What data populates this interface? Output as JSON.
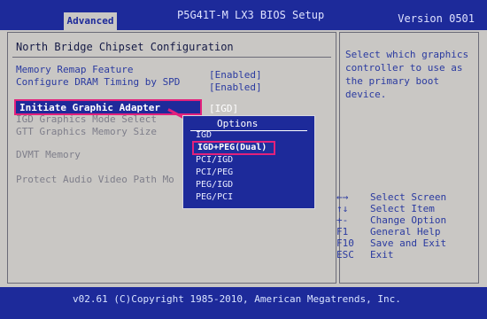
{
  "header": {
    "tab_label": "Advanced",
    "title": "P5G41T-M LX3 BIOS Setup",
    "version": "Version 0501"
  },
  "main": {
    "section_title": "North Bridge Chipset Configuration",
    "rows": [
      {
        "label": "Memory Remap Feature",
        "value": "[Enabled]"
      },
      {
        "label": "Configure DRAM Timing by SPD",
        "value": "[Enabled]"
      },
      {
        "label": "Initiate Graphic Adapter",
        "value": "[IGD]"
      },
      {
        "label": "IGD Graphics Mode Select",
        "value": ""
      },
      {
        "label": "GTT Graphics Memory Size",
        "value": ""
      },
      {
        "label": "DVMT Memory",
        "value": ""
      },
      {
        "label": "Protect Audio Video Path Mo",
        "value": ""
      }
    ]
  },
  "popup": {
    "title": "Options",
    "options": [
      "IGD",
      "IGD+PEG(Dual)",
      "PCI/IGD",
      "PCI/PEG",
      "PEG/IGD",
      "PEG/PCI"
    ],
    "selected_index": 1
  },
  "help": {
    "text": "Select which graphics controller to use as the primary boot device."
  },
  "keys": [
    {
      "key": "←→",
      "desc": "Select Screen"
    },
    {
      "key": "↑↓",
      "desc": "Select Item"
    },
    {
      "key": "+-",
      "desc": "Change Option"
    },
    {
      "key": "F1",
      "desc": "General Help"
    },
    {
      "key": "F10",
      "desc": "Save and Exit"
    },
    {
      "key": "ESC",
      "desc": "Exit"
    }
  ],
  "footer": {
    "text": "v02.61 (C)Copyright 1985-2010, American Megatrends, Inc."
  },
  "colors": {
    "bios_blue": "#1d2a9a",
    "panel_gray": "#c9c7c4",
    "highlight_pink": "#e3217b"
  }
}
